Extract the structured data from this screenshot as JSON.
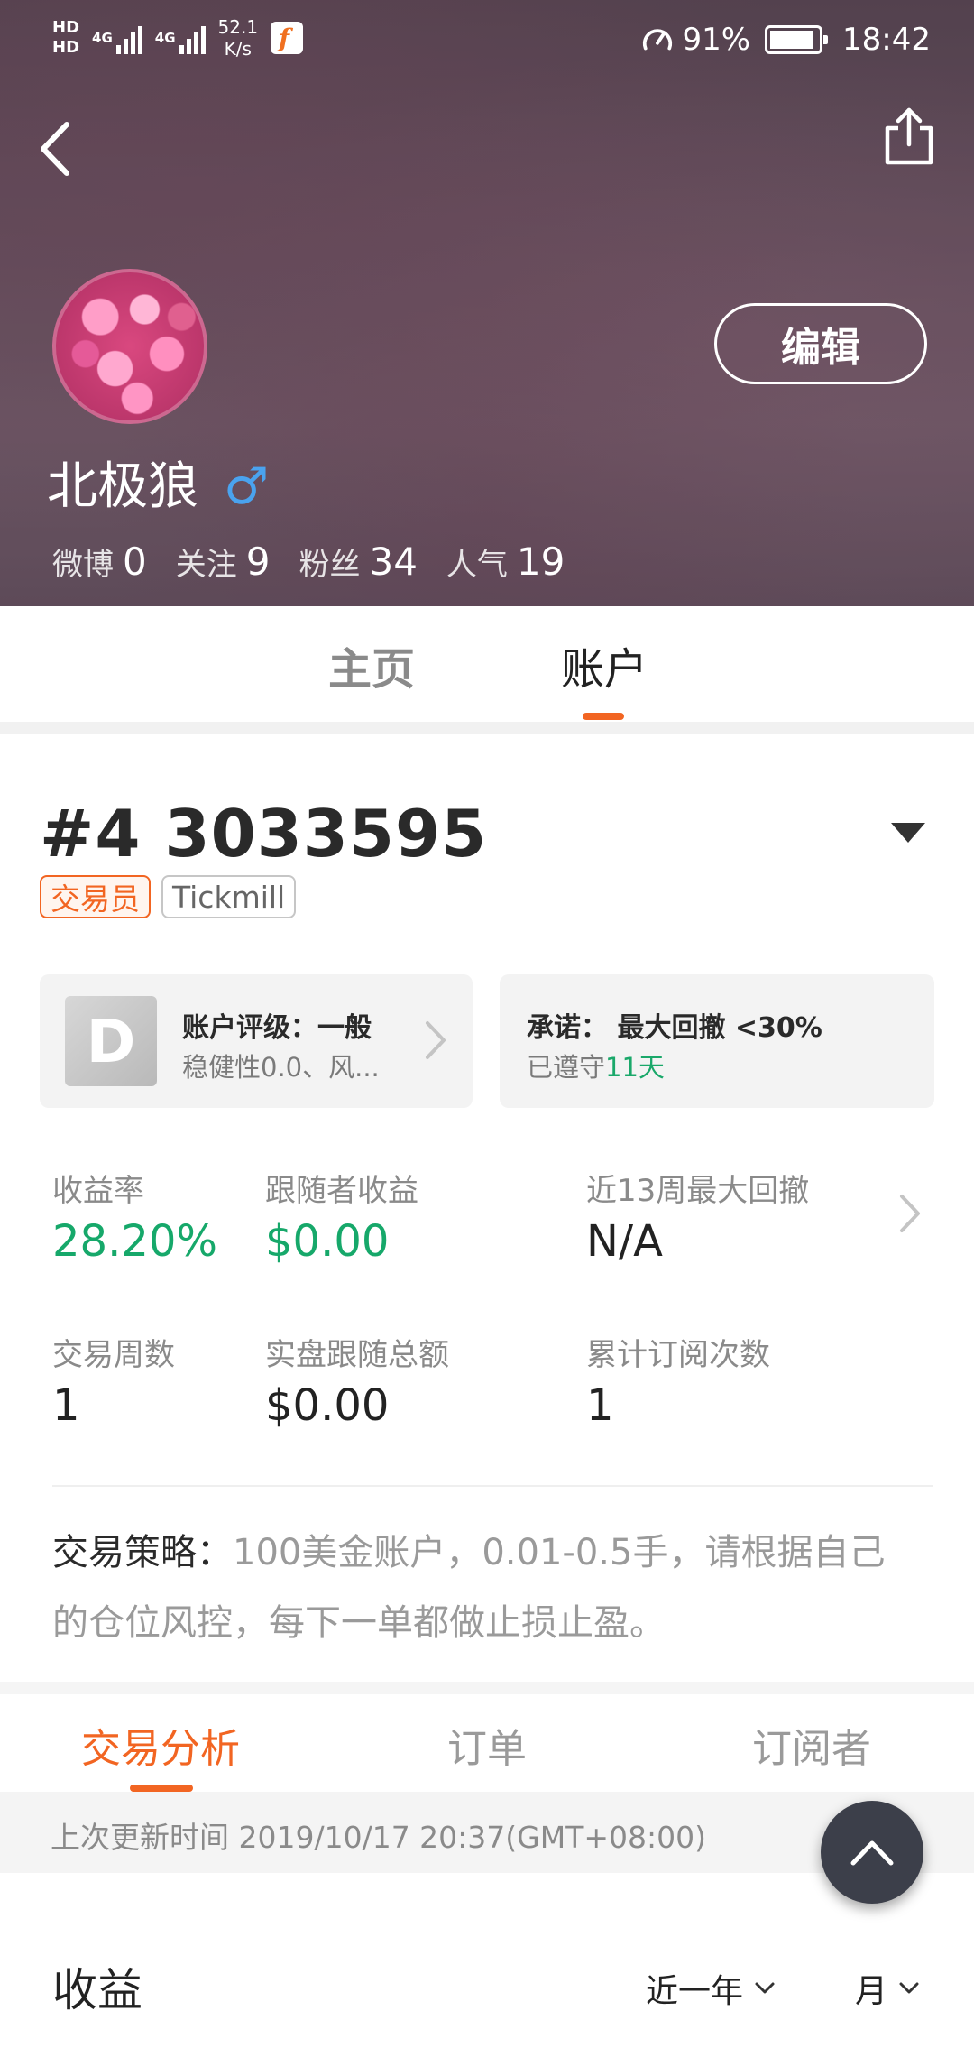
{
  "status_bar": {
    "hd1": "HD",
    "hd2": "HD",
    "sig1": "4G",
    "sig2": "4G",
    "speed_value": "52.1",
    "speed_unit": "K/s",
    "battery": "91%",
    "battery_level": 0.91,
    "time": "18:42"
  },
  "profile": {
    "edit_label": "编辑",
    "name": "北极狼",
    "gender_symbol": "♂",
    "stats": [
      {
        "label": "微博",
        "value": "0"
      },
      {
        "label": "关注",
        "value": "9"
      },
      {
        "label": "粉丝",
        "value": "34"
      },
      {
        "label": "人气",
        "value": "19"
      }
    ]
  },
  "main_tabs": {
    "home": "主页",
    "account": "账户"
  },
  "account": {
    "number": "#4 3033595",
    "tags": [
      "交易员",
      "Tickmill"
    ],
    "rating": {
      "grade": "D",
      "title": "账户评级：一般",
      "sub": "稳健性0.0、风..."
    },
    "promise": {
      "title": "承诺：  最大回撤 <30%",
      "sub_prefix": "已遵守",
      "sub_days": "11天"
    },
    "metrics": [
      {
        "label": "收益率",
        "value": "28.20%"
      },
      {
        "label": "跟随者收益",
        "value": "$0.00"
      },
      {
        "label": "近13周最大回撤",
        "value": "N/A"
      },
      {
        "label": "交易周数",
        "value": "1"
      },
      {
        "label": "实盘跟随总额",
        "value": "$0.00"
      },
      {
        "label": "累计订阅次数",
        "value": "1"
      }
    ],
    "strategy_key": "交易策略：",
    "strategy_text": "100美金账户，0.01-0.5手，请根据自己的仓位风控，每下一单都做止损止盈。"
  },
  "sub_tabs": [
    "交易分析",
    "订单",
    "订阅者"
  ],
  "update_text": "上次更新时间 2019/10/17 20:37(GMT+08:00)",
  "earnings": {
    "title": "收益",
    "period": "近一年",
    "granularity": "月"
  },
  "colors": {
    "accent": "#f26522",
    "positive": "#16a86a",
    "fab": "#3c3f4a"
  }
}
